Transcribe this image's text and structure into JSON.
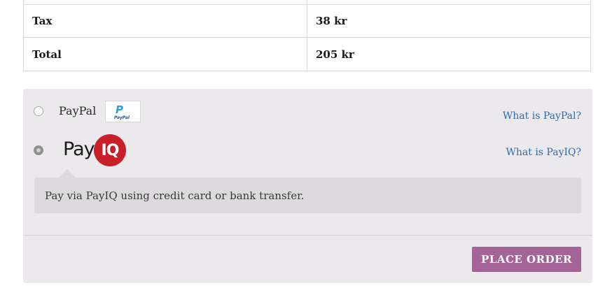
{
  "totals": {
    "rows": [
      {
        "label": "Tax",
        "value": "38 kr"
      },
      {
        "label": "Total",
        "value": "205 kr"
      }
    ]
  },
  "payment": {
    "methods": [
      {
        "label": "PayPal",
        "selected": false,
        "help_link": "What is PayPal?",
        "logo_text": "PayPal",
        "logo_mark": "P"
      },
      {
        "label": "PayIQ",
        "selected": true,
        "help_link": "What is PayIQ?",
        "logo_word": "Pay",
        "logo_badge": "IQ"
      }
    ],
    "description": "Pay via PayIQ using credit card or bank transfer.",
    "place_order_label": "PLACE ORDER"
  },
  "colors": {
    "accent": "#a46497",
    "link": "#2a6db3",
    "payiq_red": "#c7202a",
    "panel_bg": "#ebe9eb"
  }
}
